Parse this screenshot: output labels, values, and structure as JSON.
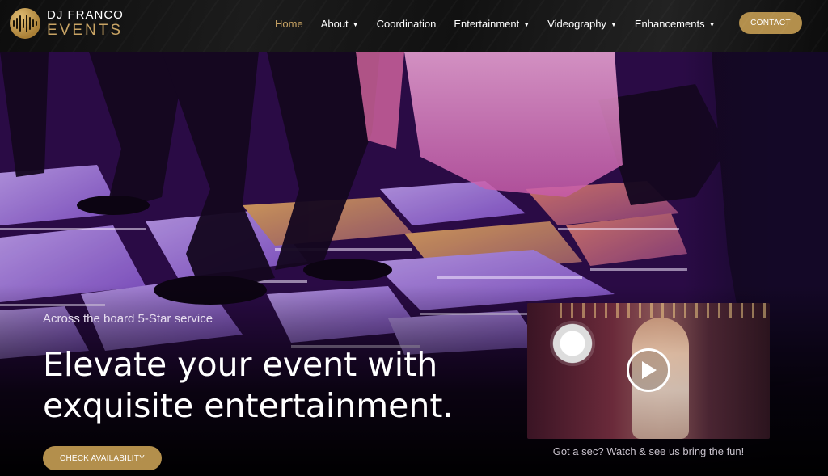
{
  "brand": {
    "line1": "DJ FRANCO",
    "line2": "EVENTS",
    "accent_color": "#b38f4c"
  },
  "nav": {
    "items": [
      {
        "label": "Home",
        "active": true,
        "dropdown": false
      },
      {
        "label": "About",
        "active": false,
        "dropdown": true
      },
      {
        "label": "Coordination",
        "active": false,
        "dropdown": false
      },
      {
        "label": "Entertainment",
        "active": false,
        "dropdown": true
      },
      {
        "label": "Videography",
        "active": false,
        "dropdown": true
      },
      {
        "label": "Enhancements",
        "active": false,
        "dropdown": true
      }
    ],
    "contact_label": "CONTACT"
  },
  "hero": {
    "tagline": "Across the board 5-Star service",
    "headline_line1": "Elevate your event with",
    "headline_line2": "exquisite entertainment.",
    "cta_label": "CHECK AVAILABILITY",
    "background_image": "dance-floor-lights"
  },
  "video": {
    "caption": "Got a sec? Watch & see us bring the fun!",
    "play_icon": "play-icon"
  }
}
